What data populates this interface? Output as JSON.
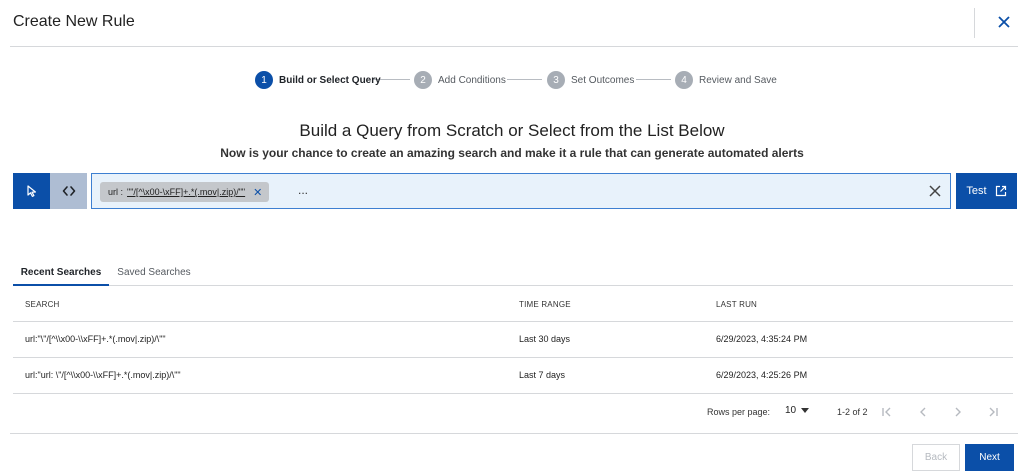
{
  "header": {
    "title": "Create New Rule",
    "close_icon": "close-icon"
  },
  "stepper": {
    "steps": [
      {
        "number": "1",
        "label": "Build or Select Query",
        "active": true
      },
      {
        "number": "2",
        "label": "Add Conditions",
        "active": false
      },
      {
        "number": "3",
        "label": "Set Outcomes",
        "active": false
      },
      {
        "number": "4",
        "label": "Review and Save",
        "active": false
      }
    ]
  },
  "build": {
    "title": "Build a Query from Scratch or Select from the List Below",
    "subtitle": "Now is your chance to create an amazing search and make it a rule that can generate automated alerts"
  },
  "query": {
    "chip_key": "url :",
    "chip_value": "\"\"/[^\\x00-\\xFF]+.*(.mov|.zip)/\"\"",
    "ellipsis": "...",
    "test_label": "Test"
  },
  "tabs": [
    {
      "label": "Recent Searches",
      "active": true
    },
    {
      "label": "Saved Searches",
      "active": false
    }
  ],
  "table": {
    "columns": [
      "SEARCH",
      "TIME RANGE",
      "LAST RUN"
    ],
    "rows": [
      {
        "search": "url:\"\\\"/[^\\\\x00-\\\\xFF]+.*(.mov|.zip)/\\\"\"",
        "time_range": "Last 30 days",
        "last_run": "6/29/2023, 4:35:24 PM"
      },
      {
        "search": "url:\"url: \\\"/[^\\\\x00-\\\\xFF]+.*(.mov|.zip)/\\\"\"",
        "time_range": "Last 7 days",
        "last_run": "6/29/2023, 4:25:26 PM"
      }
    ]
  },
  "pagination": {
    "rows_per_page_label": "Rows per page:",
    "rows_per_page": "10",
    "range": "1-2 of 2"
  },
  "footer": {
    "back_label": "Back",
    "next_label": "Next"
  },
  "colors": {
    "primary": "#0b4fa8",
    "input_bg": "#e8f2fb",
    "step_inactive": "#a7adb5",
    "divider": "#d6d8db"
  }
}
